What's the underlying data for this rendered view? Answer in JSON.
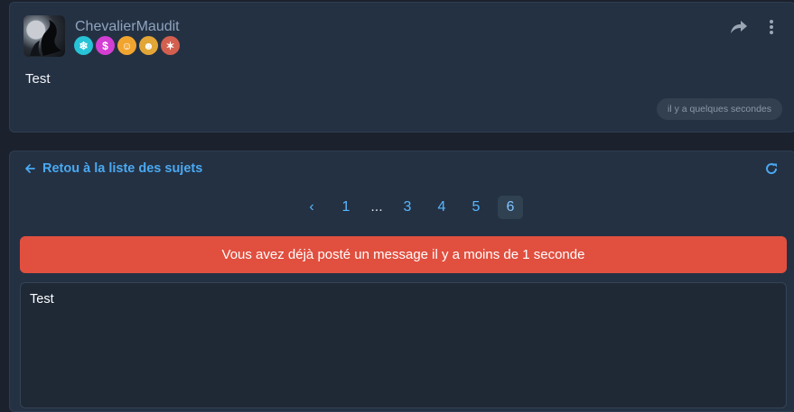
{
  "post": {
    "username": "ChevalierMaudit",
    "badges": [
      {
        "icon": "snowflake-badge-icon",
        "symbol": "❄",
        "color": "#27c3d6"
      },
      {
        "icon": "dollar-badge-icon",
        "symbol": "$",
        "color": "#d33fd2"
      },
      {
        "icon": "smiley-badge-icon",
        "symbol": "☺",
        "color": "#f1a52f"
      },
      {
        "icon": "face-badge-icon",
        "symbol": "☻",
        "color": "#e2a637"
      },
      {
        "icon": "monster-badge-icon",
        "symbol": "✶",
        "color": "#d35f4f"
      }
    ],
    "text": "Test",
    "time": "il y a quelques secondes"
  },
  "topic": {
    "back_label": "Retou à la liste des sujets",
    "pagination": {
      "prev_symbol": "‹",
      "pages": [
        "1",
        "...",
        "3",
        "4",
        "5",
        "6"
      ],
      "active": "6"
    },
    "alert_text": "Vous avez déjà posté un message il y a moins de 1 seconde",
    "editor_text": "Test"
  },
  "colors": {
    "background": "#1b222d",
    "card": "#243143",
    "accent": "#4aa9f1",
    "alert": "#e14f3f"
  }
}
